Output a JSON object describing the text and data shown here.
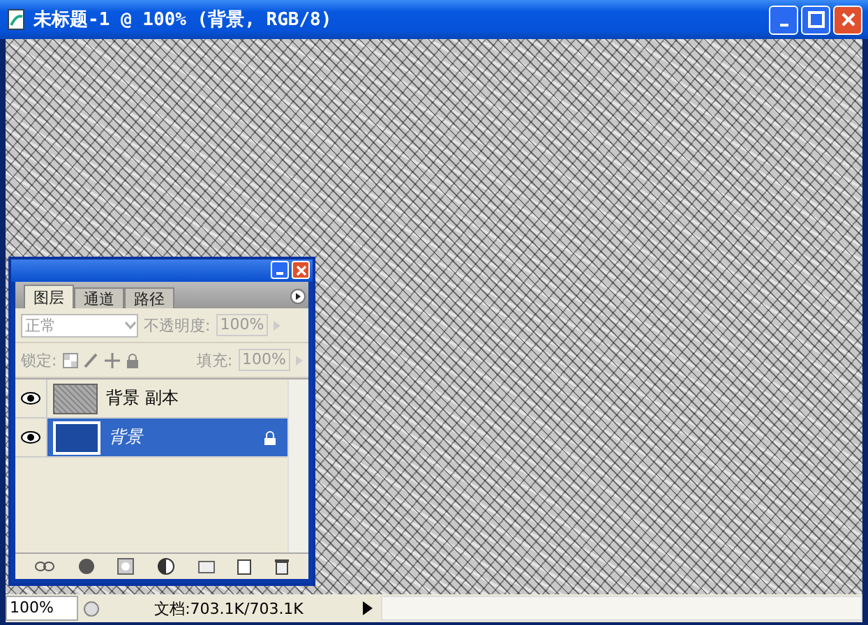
{
  "window": {
    "title": "未标题-1 @ 100% (背景, RGB/8)"
  },
  "layers_panel": {
    "tabs": [
      {
        "label": "图层",
        "selected": true
      },
      {
        "label": "通道",
        "selected": false
      },
      {
        "label": "路径",
        "selected": false
      }
    ],
    "blend_mode": {
      "value": "正常",
      "disabled": true
    },
    "opacity": {
      "label": "不透明度:",
      "value": "100%",
      "disabled": true
    },
    "lock_label": "锁定:",
    "fill": {
      "label": "填充:",
      "value": "100%",
      "disabled": true
    },
    "layers": [
      {
        "name": "背景 副本",
        "kind": "copy",
        "visible": true,
        "selected": false,
        "locked": false
      },
      {
        "name": "背景",
        "kind": "background",
        "visible": true,
        "selected": true,
        "locked": true
      }
    ]
  },
  "status_bar": {
    "zoom": "100%",
    "doc_info": "文档:703.1K/703.1K"
  }
}
